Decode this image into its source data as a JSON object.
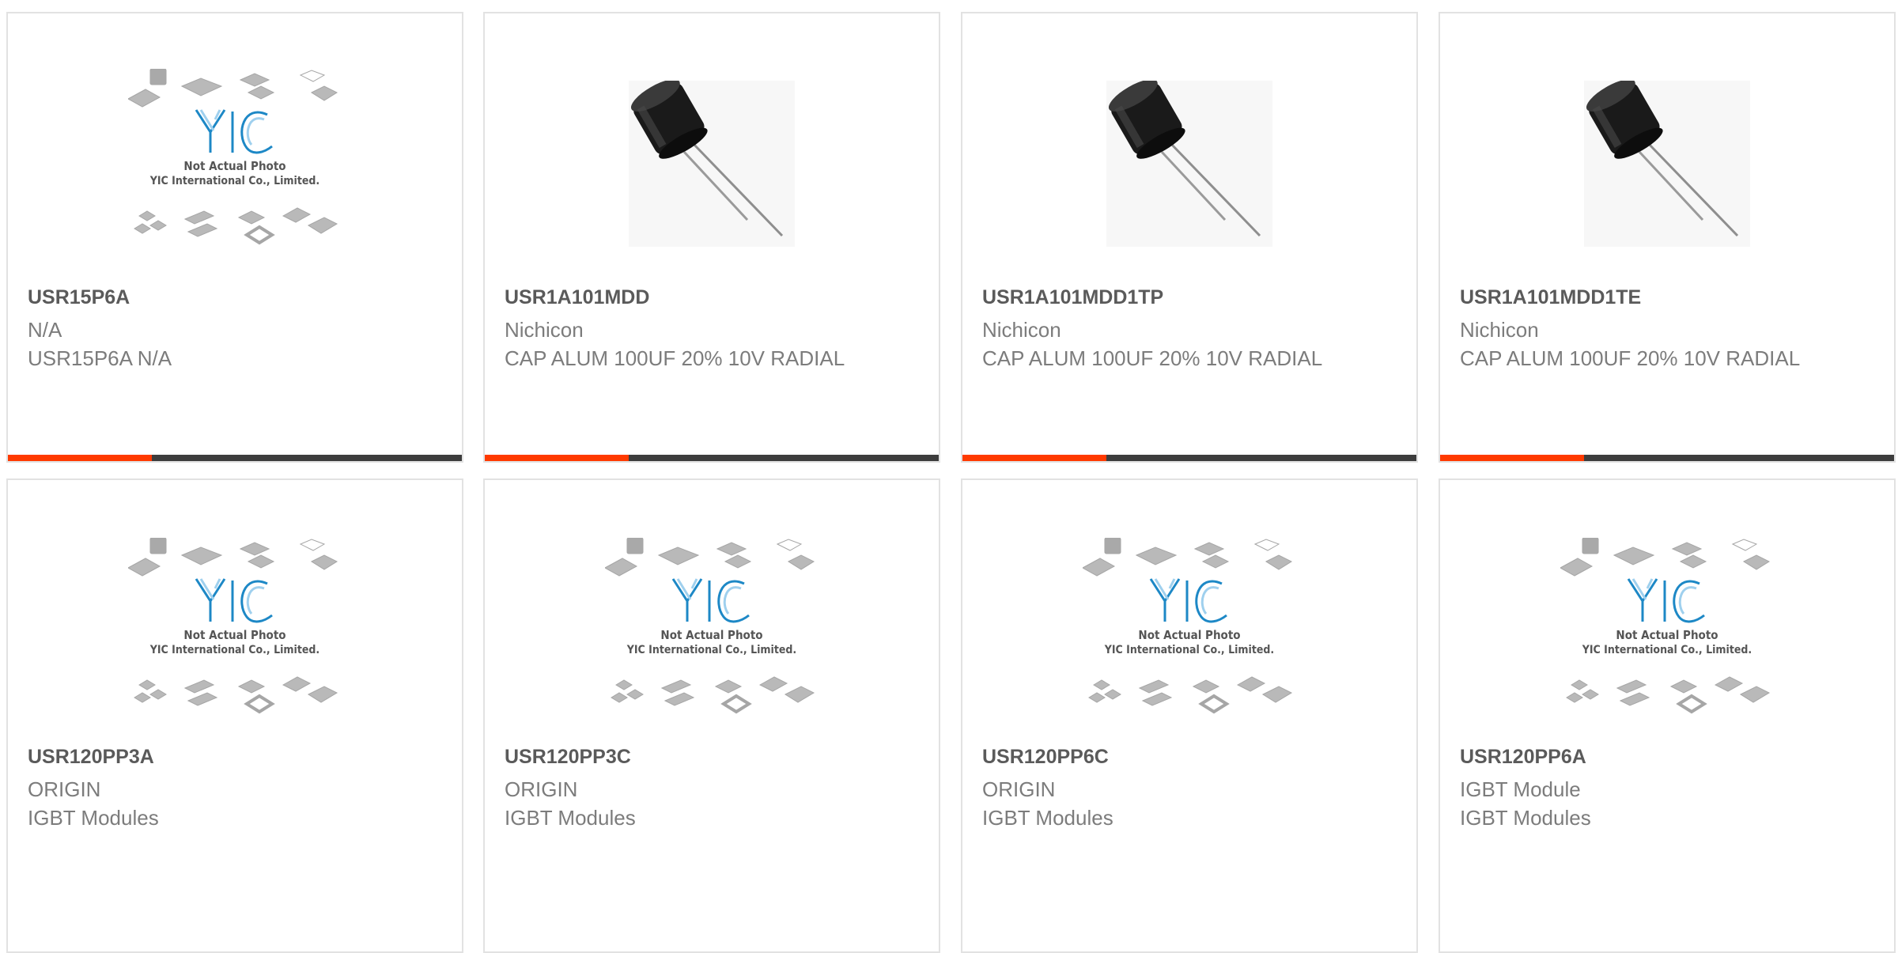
{
  "accent_color": "#ff3a00",
  "bar_color": "#3d3d3d",
  "placeholder_image": {
    "line1": "Not Actual Photo",
    "line2": "YIC International Co., Limited.",
    "logo_text": "YIC"
  },
  "products": [
    {
      "part_number": "USR15P6A",
      "manufacturer": "N/A",
      "description": "USR15P6A N/A",
      "image": "placeholder"
    },
    {
      "part_number": "USR1A101MDD",
      "manufacturer": "Nichicon",
      "description": "CAP ALUM 100UF 20% 10V RADIAL",
      "image": "capacitor"
    },
    {
      "part_number": "USR1A101MDD1TP",
      "manufacturer": "Nichicon",
      "description": "CAP ALUM 100UF 20% 10V RADIAL",
      "image": "capacitor"
    },
    {
      "part_number": "USR1A101MDD1TE",
      "manufacturer": "Nichicon",
      "description": "CAP ALUM 100UF 20% 10V RADIAL",
      "image": "capacitor"
    },
    {
      "part_number": "USR120PP3A",
      "manufacturer": "ORIGIN",
      "description": "IGBT Modules",
      "image": "placeholder"
    },
    {
      "part_number": "USR120PP3C",
      "manufacturer": "ORIGIN",
      "description": "IGBT Modules",
      "image": "placeholder"
    },
    {
      "part_number": "USR120PP6C",
      "manufacturer": "ORIGIN",
      "description": "IGBT Modules",
      "image": "placeholder"
    },
    {
      "part_number": "USR120PP6A",
      "manufacturer": "IGBT Module",
      "description": "IGBT Modules",
      "image": "placeholder"
    }
  ]
}
